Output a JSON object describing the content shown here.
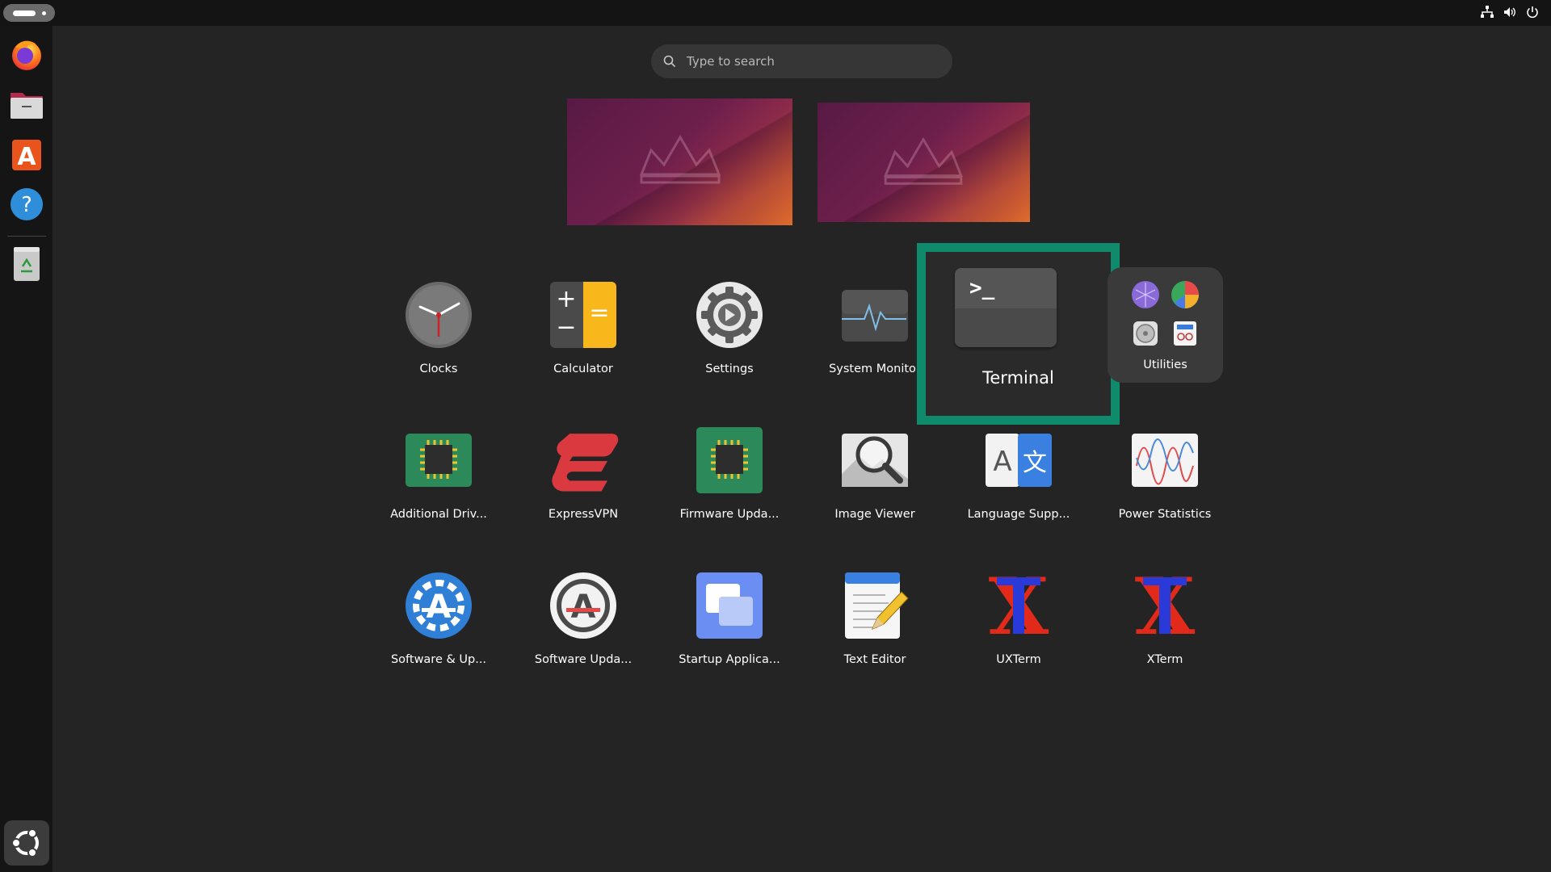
{
  "search": {
    "placeholder": "Type to search"
  },
  "dock": {
    "items": [
      {
        "name": "Firefox",
        "icon": "firefox-icon"
      },
      {
        "name": "Files",
        "icon": "files-icon"
      },
      {
        "name": "App Center",
        "icon": "app-center-icon"
      },
      {
        "name": "Help",
        "icon": "help-icon"
      },
      {
        "name": "Trash",
        "icon": "trash-icon"
      }
    ],
    "show_apps_icon": "ubuntu-logo-icon"
  },
  "tray": {
    "icons": [
      "network-icon",
      "volume-icon",
      "power-icon"
    ]
  },
  "apps": [
    {
      "label": "Clocks",
      "icon": "clock-icon"
    },
    {
      "label": "Calculator",
      "icon": "calculator-icon"
    },
    {
      "label": "Settings",
      "icon": "settings-gear-icon"
    },
    {
      "label": "System Monitor",
      "icon": "system-monitor-icon"
    },
    {
      "label": "Terminal",
      "icon": "terminal-icon",
      "highlighted": true
    },
    {
      "label": "Utilities",
      "icon": "folder-icon"
    },
    {
      "label": "Additional Driv...",
      "icon": "chip-icon"
    },
    {
      "label": "ExpressVPN",
      "icon": "expressvpn-icon"
    },
    {
      "label": "Firmware Upda...",
      "icon": "firmware-chip-icon"
    },
    {
      "label": "Image Viewer",
      "icon": "image-viewer-icon"
    },
    {
      "label": "Language Supp...",
      "icon": "language-icon"
    },
    {
      "label": "Power Statistics",
      "icon": "power-statistics-icon"
    },
    {
      "label": "Software & Up...",
      "icon": "software-updates-icon"
    },
    {
      "label": "Software Upda...",
      "icon": "software-updater-icon"
    },
    {
      "label": "Startup Applica...",
      "icon": "startup-apps-icon"
    },
    {
      "label": "Text Editor",
      "icon": "text-editor-icon"
    },
    {
      "label": "UXTerm",
      "icon": "xterm-icon"
    },
    {
      "label": "XTerm",
      "icon": "xterm-icon"
    }
  ],
  "terminal_prompt": ">_",
  "icon_glyphs": {
    "calculator_plus": "+",
    "calculator_minus": "−",
    "calculator_equals": "=",
    "help_mark": "?",
    "language_latin": "A",
    "language_cjk": "文",
    "xterm_letter": "X"
  },
  "colors": {
    "highlight": "#0f8a6a",
    "background": "#242424",
    "dock": "#151515",
    "topbar": "#141414"
  }
}
